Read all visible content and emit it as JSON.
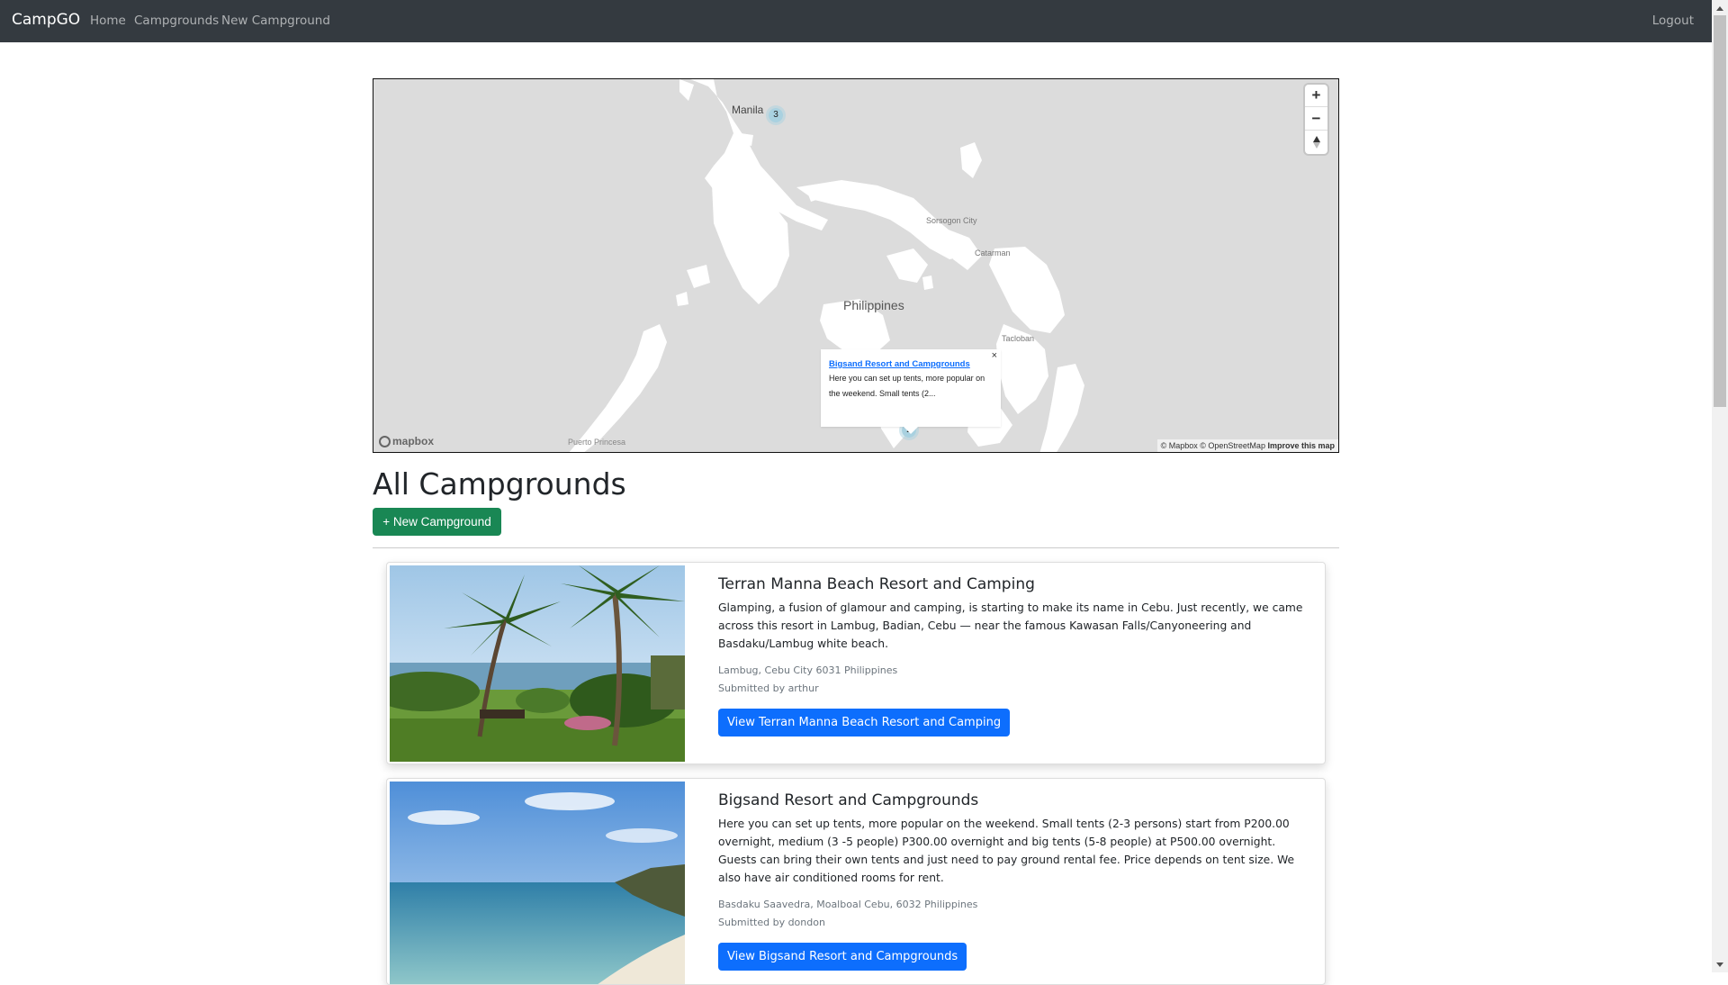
{
  "navbar": {
    "brand": "CampGO",
    "links": [
      "Home",
      "Campgrounds",
      "New Campground"
    ],
    "logout": "Logout"
  },
  "map": {
    "labels": {
      "manila": "Manila",
      "philippines": "Philippines",
      "sorsogon": "Sorsogon City",
      "catarman": "Catarman",
      "tacloban": "Tacloban",
      "puerto": "Puerto Princesa"
    },
    "clusters": [
      "3",
      "2"
    ],
    "zoom_in": "+",
    "zoom_out": "−",
    "popup": {
      "close": "×",
      "title": "Bigsand Resort and Campgrounds",
      "text": "Here you can set up tents, more popular on the weekend. Small tents (2..."
    },
    "logo": "mapbox",
    "attribution": "© Mapbox © OpenStreetMap",
    "improve": "Improve this map"
  },
  "page": {
    "title": "All Campgrounds",
    "new_button": "+ New Campground"
  },
  "campgrounds": [
    {
      "title": "Terran Manna Beach Resort and Camping",
      "description": "Glamping, a fusion of glamour and camping, is starting to make its name in Cebu. Just recently, we came across this resort in Lambug, Badian, Cebu — near the famous Kawasan Falls/Canyoneering and Basdaku/Lambug white beach.",
      "location": "Lambug, Cebu City 6031 Philippines",
      "submitted_by": "Submitted by arthur",
      "button": "View Terran Manna Beach Resort and Camping"
    },
    {
      "title": "Bigsand Resort and Campgrounds",
      "description": "Here you can set up tents, more popular on the weekend. Small tents (2-3 persons) start from P200.00 overnight, medium (3 -5 people) P300.00 overnight and big tents (5-8 people) at P500.00 overnight. Guests can bring their own tents and just need to pay ground rental fee. Price depends on tent size. We also have air conditioned rooms for rent.",
      "location": "Basdaku Saavedra, Moalboal Cebu, 6032 Philippines",
      "submitted_by": "Submitted by dondon",
      "button": "View Bigsand Resort and Campgrounds"
    }
  ]
}
